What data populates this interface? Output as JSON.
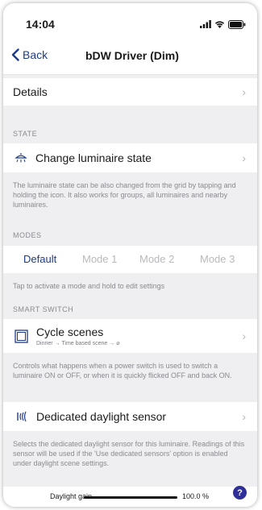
{
  "status_bar": {
    "time": "14:04"
  },
  "nav": {
    "back_label": "Back",
    "title": "bDW Driver (Dim)"
  },
  "details": {
    "label": "Details"
  },
  "state": {
    "header": "STATE",
    "item_label": "Change luminaire state",
    "note": "The luminaire state can be also changed from the grid by tapping and holding the icon. It also works for groups, all luminaires and nearby luminaires."
  },
  "modes": {
    "header": "MODES",
    "items": [
      "Default",
      "Mode 1",
      "Mode 2",
      "Mode 3"
    ],
    "selected": "Default",
    "note": "Tap to activate a mode and hold to edit settings"
  },
  "smart_switch": {
    "header": "SMART SWITCH",
    "item_label": "Cycle scenes",
    "item_sub": "Dinner → Time based scene → ⌀",
    "note": "Controls what happens when a power switch is used to switch a luminaire ON or OFF, or when it is quickly flicked OFF and back ON."
  },
  "daylight": {
    "item_label": "Dedicated daylight sensor",
    "note": "Selects the dedicated daylight sensor for this luminaire. Readings of this sensor will be used if the 'Use dedicated sensors' option is enabled under daylight scene settings."
  },
  "gain": {
    "label": "Daylight gain",
    "value": "100.0 %"
  },
  "help": {
    "label": "?"
  },
  "colors": {
    "accent": "#1e3a8a",
    "background": "#efeff1",
    "help": "#2f2f9a"
  },
  "icons": {
    "chevron": "chevron-right-icon",
    "back": "chevron-left-icon",
    "luminaire": "ceiling-lamp-icon",
    "scenes": "square-frame-icon",
    "sensor": "daylight-sensor-icon"
  }
}
